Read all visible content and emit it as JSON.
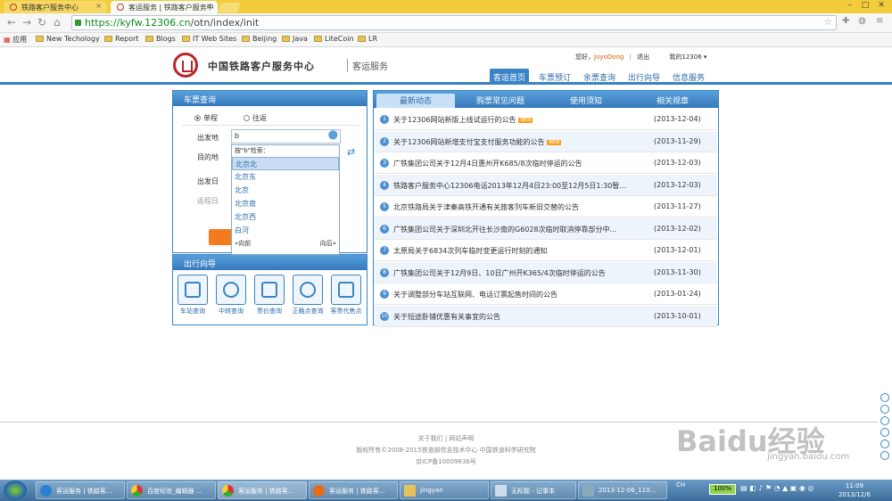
{
  "browser": {
    "tabs": [
      {
        "label": "铁路客户服务中心"
      },
      {
        "label": "客运服务 | 铁路客户服务中"
      }
    ],
    "url_scheme": "https://",
    "url_host": "kyfw.12306.cn",
    "url_path": "/otn/index/init",
    "bookmarks": [
      "应用",
      "New Techology",
      "Report",
      "Blogs",
      "IT Web Sites",
      "Beijing",
      "Java",
      "LiteCoin",
      "LR"
    ]
  },
  "header": {
    "site_name": "中国铁路客户服务中心",
    "site_sub": "客运服务",
    "greeting": "您好，",
    "username": "JoyoDong",
    "logout": "退出",
    "my_account": "我的12306",
    "nav": [
      "客运首页",
      "车票预订",
      "余票查询",
      "出行向导",
      "信息服务"
    ]
  },
  "ticket": {
    "title": "车票查询",
    "one_way": "单程",
    "round_trip": "往返",
    "from_label": "出发地",
    "from_value": "b",
    "to_label": "目的地",
    "date_label": "出发日",
    "return_label": "返程日",
    "dropdown_hint": "按\"b\"检索：",
    "dropdown_items": [
      "北京北",
      "北京东",
      "北京",
      "北京南",
      "北京西",
      "白河"
    ],
    "prev": "«向前",
    "next": "向后»"
  },
  "guide": {
    "title": "出行向导",
    "items": [
      "车站查询",
      "中转查询",
      "票价查询",
      "正晚点查询",
      "客票代售点"
    ]
  },
  "news": {
    "tabs": [
      "最新动态",
      "购票常见问题",
      "使用须知",
      "相关规章"
    ],
    "new_badge": "NEW",
    "rows": [
      {
        "num": "1",
        "title": "关于12306网站新版上线试运行的公告",
        "new": true,
        "date": "(2013-12-04)"
      },
      {
        "num": "2",
        "title": "关于12306网站新增支付宝支付服务功能的公告",
        "new": true,
        "date": "(2013-11-29)"
      },
      {
        "num": "3",
        "title": "广铁集团公司关于12月4日惠州开K685/8次临时停运的公告",
        "new": false,
        "date": "(2013-12-03)"
      },
      {
        "num": "4",
        "title": "铁路客户服务中心12306电话2013年12月4日23:00至12月5日1:30暂...",
        "new": false,
        "date": "(2013-12-03)"
      },
      {
        "num": "5",
        "title": "北京铁路局关于津秦高铁开通有关旅客列车新旧交替的公告",
        "new": false,
        "date": "(2013-11-27)"
      },
      {
        "num": "6",
        "title": "广铁集团公司关于深圳北开往长沙南的G6028次临时取消停靠部分中...",
        "new": false,
        "date": "(2013-12-02)"
      },
      {
        "num": "7",
        "title": "太原局关于6834次列车临时变更运行时刻的通知",
        "new": false,
        "date": "(2013-12-01)"
      },
      {
        "num": "8",
        "title": "广铁集团公司关于12月9日、10日广州开K365/4次临时停运的公告",
        "new": false,
        "date": "(2013-11-30)"
      },
      {
        "num": "9",
        "title": "关于调整部分车站互联网、电话订票起售时间的公告",
        "new": false,
        "date": "(2013-01-24)"
      },
      {
        "num": "10",
        "title": "关于短途卧铺优惠有关事宜的公告",
        "new": false,
        "date": "(2013-10-01)"
      }
    ]
  },
  "footer": {
    "links": "关于我们 | 网站声明",
    "copyright": "版权所有©2008-2015铁道部信息技术中心   中国铁道科学研究院",
    "icp": "京ICP备10009636号"
  },
  "watermark": {
    "logo": "Baidu经验",
    "url": "jingyan.baidu.com"
  },
  "taskbar": {
    "items": [
      "客运服务 | 铁路客...",
      "百度经验_编辑器 ...",
      "客运服务 | 铁路客...",
      "客运服务 | 铁路客...",
      "jingyan",
      "无标题 - 记事本",
      "2013-12-06_110..."
    ],
    "lang": "CH",
    "zoom": "100%",
    "time": "11:09",
    "date": "2013/12/6"
  }
}
